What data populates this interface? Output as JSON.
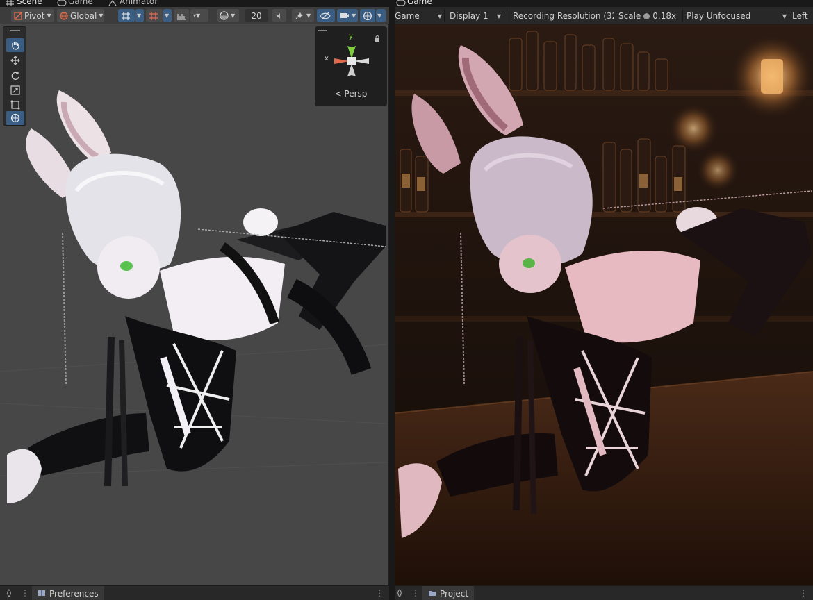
{
  "scene_window": {
    "tabs": [
      {
        "label": "Scene",
        "icon": "hash-icon"
      },
      {
        "label": "Game",
        "icon": "gamepad-icon"
      },
      {
        "label": "Animator",
        "icon": "animator-icon"
      }
    ],
    "toolbar": {
      "pivot_label": "Pivot",
      "global_label": "Global",
      "grid_size_value": "20"
    },
    "tools": [
      {
        "name": "hand-tool",
        "icon": "hand-icon",
        "active": true
      },
      {
        "name": "move-tool",
        "icon": "move-icon",
        "active": false
      },
      {
        "name": "rotate-tool",
        "icon": "rotate-icon",
        "active": false
      },
      {
        "name": "scale-tool",
        "icon": "scale-icon",
        "active": false
      },
      {
        "name": "rect-tool",
        "icon": "rect-icon",
        "active": false
      },
      {
        "name": "transform-tool",
        "icon": "transform-icon",
        "active": true
      }
    ],
    "gizmo": {
      "y_label": "y",
      "x_label": "x",
      "projection_label": "< Persp"
    },
    "bottom_tab": {
      "label": "Preferences",
      "icon": "preferences-icon"
    }
  },
  "game_window": {
    "tab": {
      "label": "Game",
      "icon": "gamepad-icon"
    },
    "toolbar": {
      "mode_label": "Game",
      "display_label": "Display 1",
      "resolution_label": "Recording Resolution (32",
      "scale_label": "Scale",
      "scale_value": "0.18x",
      "play_mode_label": "Play Unfocused",
      "left_label": "Left"
    },
    "bottom_tab": {
      "label": "Project",
      "icon": "folder-icon"
    }
  },
  "colors": {
    "toolbar_bg": "#3c3c3c",
    "accent_blue": "#3a5d84",
    "scene_bg": "#474747",
    "game_bg": "#1a0f0a"
  }
}
